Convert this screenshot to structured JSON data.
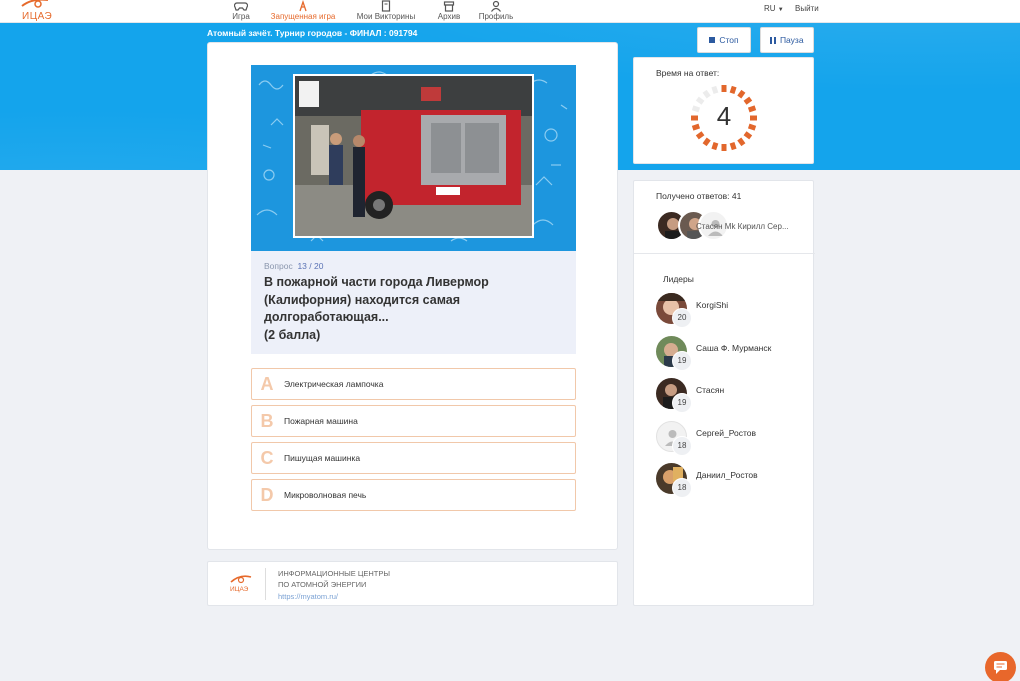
{
  "brand": {
    "logo_text": "ИЦАЭ",
    "accent": "#e66a2c",
    "blue": "#14a4ec"
  },
  "nav": {
    "items": [
      {
        "label": "Игра",
        "icon": "gamepad-icon"
      },
      {
        "label": "Запущенная игра",
        "icon": "running-game-icon",
        "active": true
      },
      {
        "label": "Мои Викторины",
        "icon": "quiz-book-icon"
      },
      {
        "label": "Архив",
        "icon": "archive-icon"
      },
      {
        "label": "Профиль",
        "icon": "user-icon"
      }
    ],
    "lang": "RU",
    "logout": "Выйти"
  },
  "game": {
    "title": "Атомный зачёт. Турнир городов - ФИНАЛ : 091794",
    "stop_label": "Стоп",
    "pause_label": "Пауза"
  },
  "question": {
    "label": "Вопрос",
    "current": "13",
    "total": "20",
    "text": "В пожарной части города Ливермор (Калифорния) находится самая долгоработающая...\n(2 балла)",
    "image_alt": "fire-truck-photo",
    "answers": [
      {
        "letter": "A",
        "text": "Электрическая лампочка"
      },
      {
        "letter": "B",
        "text": "Пожарная машина"
      },
      {
        "letter": "C",
        "text": "Пишущая машинка"
      },
      {
        "letter": "D",
        "text": "Микроволновая печь"
      }
    ]
  },
  "footer": {
    "line1": "ИНФОРМАЦИОННЫЕ ЦЕНТРЫ",
    "line2": "ПО АТОМНОЙ ЭНЕРГИИ",
    "link": "https://myatom.ru/",
    "logo_text": "ИЦАЭ"
  },
  "timer": {
    "label": "Время на ответ:",
    "value": "4",
    "remaining_fraction": 0.8,
    "color": "#e2672c"
  },
  "responses": {
    "label": "Получено ответов: 41",
    "names": "Стасян  Mk  Кирилл  Сер..."
  },
  "leaders": {
    "title": "Лидеры",
    "list": [
      {
        "name": "KorgiShi",
        "score": "20"
      },
      {
        "name": "Саша Ф. Мурманск",
        "score": "19"
      },
      {
        "name": "Стасян",
        "score": "19"
      },
      {
        "name": "Сергей_Ростов",
        "score": "18"
      },
      {
        "name": "Даниил_Ростов",
        "score": "18"
      }
    ]
  }
}
